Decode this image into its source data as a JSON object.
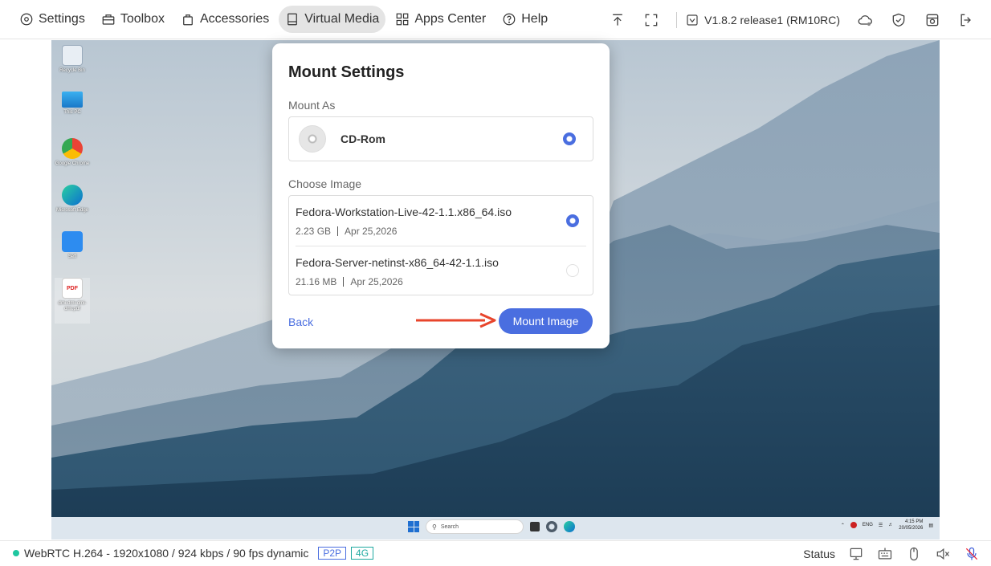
{
  "menu": {
    "items": [
      {
        "label": "Settings",
        "icon": "gear-icon"
      },
      {
        "label": "Toolbox",
        "icon": "toolbox-icon"
      },
      {
        "label": "Accessories",
        "icon": "bag-icon"
      },
      {
        "label": "Virtual Media",
        "icon": "drive-icon",
        "active": true
      },
      {
        "label": "Apps Center",
        "icon": "apps-icon"
      },
      {
        "label": "Help",
        "icon": "help-icon"
      }
    ]
  },
  "toolbar": {
    "version": "V1.8.2 release1 (RM10RC)"
  },
  "desktop": {
    "icons": [
      {
        "label": "Recycle Bin"
      },
      {
        "label": "This PC"
      },
      {
        "label": "Google Chrome"
      },
      {
        "label": "Microsoft Edge"
      },
      {
        "label": "Sefl"
      },
      {
        "label": "dmi-dmi-dmi-dmi.pdf"
      }
    ],
    "taskbar": {
      "search_placeholder": "Search",
      "lang": "ENG",
      "time": "4:15 PM",
      "date": "20/05/2026"
    }
  },
  "modal": {
    "title": "Mount Settings",
    "mount_as_label": "Mount As",
    "mount_option": "CD-Rom",
    "choose_image_label": "Choose Image",
    "images": [
      {
        "name": "Fedora-Workstation-Live-42-1.1.x86_64.iso",
        "size": "2.23 GB",
        "date": "Apr 25,2026",
        "selected": true
      },
      {
        "name": "Fedora-Server-netinst-x86_64-42-1.1.iso",
        "size": "21.16 MB",
        "date": "Apr 25,2026",
        "selected": false
      }
    ],
    "back_label": "Back",
    "mount_button": "Mount Image"
  },
  "statusbar": {
    "stream_info": "WebRTC H.264 - 1920x1080 /  924 kbps / 90 fps dynamic",
    "badge_p2p": "P2P",
    "badge_4g": "4G",
    "status_label": "Status"
  },
  "colors": {
    "accent": "#4a6ee0",
    "status_ok": "#1fc7a0",
    "arrow": "#e8452c"
  }
}
